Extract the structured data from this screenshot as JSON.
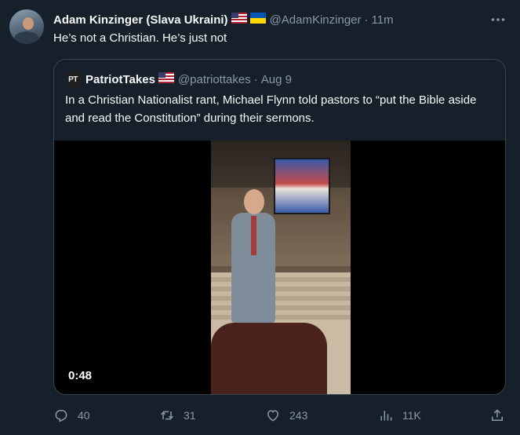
{
  "tweet": {
    "author_name": "Adam Kinzinger (Slava Ukraini)",
    "handle": "@AdamKinzinger",
    "separator": "·",
    "time": "11m",
    "text": "He’s not a Christian.  He’s just not"
  },
  "quote": {
    "avatar_initials": "PT",
    "author_name": "PatriotTakes",
    "handle": "@patriottakes",
    "separator": "·",
    "date": "Aug 9",
    "text": "In a Christian Nationalist rant, Michael Flynn told pastors to “put the Bible aside and read the Constitution” during their sermons.",
    "video_duration": "0:48"
  },
  "actions": {
    "replies": "40",
    "retweets": "31",
    "likes": "243",
    "views": "11K"
  },
  "icons": {
    "reply": "reply-icon",
    "retweet": "retweet-icon",
    "like": "heart-icon",
    "views": "views-icon",
    "share": "share-icon",
    "more": "more-icon"
  },
  "colors": {
    "background": "#15202b",
    "secondary_text": "#8b98a5",
    "border": "#38444d"
  }
}
